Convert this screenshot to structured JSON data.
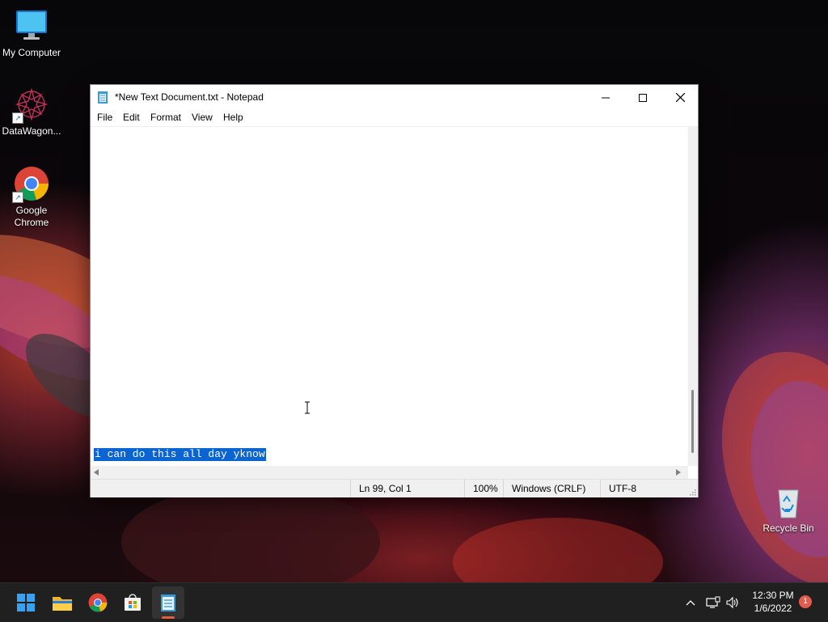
{
  "desktop": {
    "icons": [
      {
        "label": "My Computer"
      },
      {
        "label": "DataWagon..."
      },
      {
        "label": "Google Chrome"
      },
      {
        "label": "Recycle Bin"
      }
    ]
  },
  "window": {
    "title": "*New Text Document.txt - Notepad",
    "menu": [
      "File",
      "Edit",
      "Format",
      "View",
      "Help"
    ],
    "content_text": "i can do this all day yknow",
    "status": {
      "position": "Ln 99, Col 1",
      "zoom": "100%",
      "line_ending": "Windows (CRLF)",
      "encoding": "UTF-8"
    }
  },
  "taskbar": {
    "time": "12:30 PM",
    "date": "1/6/2022",
    "notification_count": "1"
  },
  "colors": {
    "selection": "#0a64d2",
    "taskbar": "#202020",
    "notification": "#e25b4b"
  }
}
